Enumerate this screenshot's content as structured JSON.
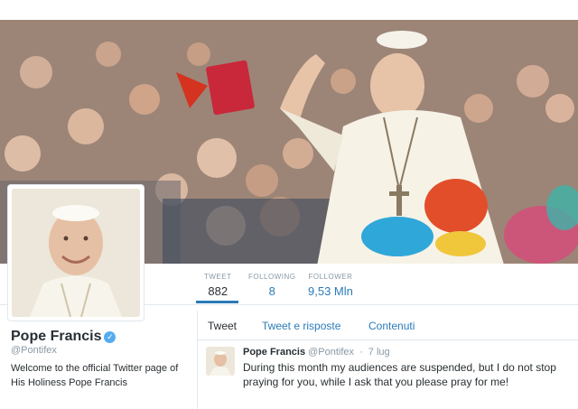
{
  "profile": {
    "name": "Pope Francis",
    "handle": "@Pontifex",
    "bio": "Welcome to the official Twitter page of His Holiness Pope Francis"
  },
  "stats": [
    {
      "label": "TWEET",
      "value": "882"
    },
    {
      "label": "FOLLOWING",
      "value": "8"
    },
    {
      "label": "FOLLOWER",
      "value": "9,53 Mln"
    }
  ],
  "tabs": [
    {
      "label": "Tweet"
    },
    {
      "label": "Tweet e risposte"
    },
    {
      "label": "Contenuti"
    }
  ],
  "tweet": {
    "author": "Pope Francis",
    "handle": "@Pontifex",
    "separator": "·",
    "date": "7 lug",
    "text": "During this month my audiences are suspended, but I do not stop praying for you, while I ask that you please pray for me!"
  },
  "colors": {
    "accent": "#2b7bb9",
    "verified": "#55acee",
    "muted": "#8899a6"
  },
  "icons": {
    "verified": "verified-badge-icon"
  }
}
